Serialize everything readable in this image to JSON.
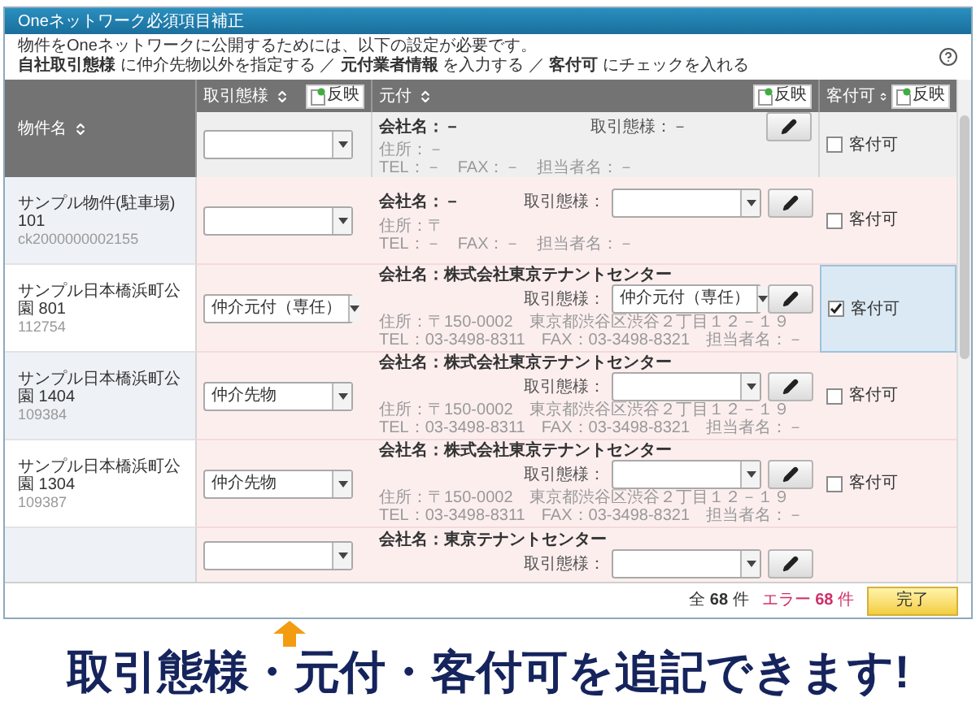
{
  "window": {
    "title": "Oneネットワーク必須項目補正"
  },
  "notice": {
    "line_1": "物件をOneネットワークに公開するためには、以下の設定が必要です。",
    "line_2": "**自社取引態様** に仲介先物以外を指定する ／ **元付業者情報** を入力する ／ **客付可** にチェックを入れる"
  },
  "columns": [
    {
      "label": "物件名"
    },
    {
      "label": "取引態様",
      "button": "反映"
    },
    {
      "label": "元付",
      "button": "反映"
    },
    {
      "label": "客付可",
      "button": "反映"
    }
  ],
  "filter_row": {
    "company": "会社名：－",
    "deal_label": "取引態様：－",
    "address": "住所：－",
    "contact": "TEL：－　FAX：－　担当者名：－",
    "checkbox_label": "客付可",
    "checked": false
  },
  "rows": [
    {
      "name": "サンプル物件(駐車場) 101",
      "code": "ck2000000002155",
      "company": "会社名：－",
      "deal_label": "取引態様：",
      "address": "住所：〒",
      "contact": "TEL：－　FAX：－　担当者名：－",
      "checkbox_label": "客付可",
      "checked": false
    },
    {
      "name": "サンプル日本橋浜町公園 801",
      "code": "112754",
      "deal_type": "仲介元付（専任）",
      "company": "会社名：株式会社東京テナントセンター",
      "deal_label": "取引態様：",
      "agent_deal_type": "仲介元付（専任）",
      "address": "住所：〒150-0002　東京都渋谷区渋谷２丁目１２－１９",
      "contact": "TEL：03-3498-8311　FAX：03-3498-8321　担当者名：－",
      "checkbox_label": "客付可",
      "checked": true
    },
    {
      "name": "サンプル日本橋浜町公園 1404",
      "code": "109384",
      "deal_type": "仲介先物",
      "company": "会社名：株式会社東京テナントセンター",
      "deal_label": "取引態様：",
      "address": "住所：〒150-0002　東京都渋谷区渋谷２丁目１２－１９",
      "contact": "TEL：03-3498-8311　FAX：03-3498-8321　担当者名：－",
      "checkbox_label": "客付可",
      "checked": false
    },
    {
      "name": "サンプル日本橋浜町公園 1304",
      "code": "109387",
      "deal_type": "仲介先物",
      "company": "会社名：株式会社東京テナントセンター",
      "deal_label": "取引態様：",
      "address": "住所：〒150-0002　東京都渋谷区渋谷２丁目１２－１９",
      "contact": "TEL：03-3498-8311　FAX：03-3498-8321　担当者名：－",
      "checkbox_label": "客付可",
      "checked": false
    }
  ],
  "partial_row": {
    "company": "会社名：東京テナントセンター",
    "deal_label": "取引態様："
  },
  "footer": {
    "total": "全 **68** 件",
    "errors": "エラー **68** 件",
    "done_button": "完了"
  },
  "caption": "取引態様・元付・客付可を追記できます!"
}
